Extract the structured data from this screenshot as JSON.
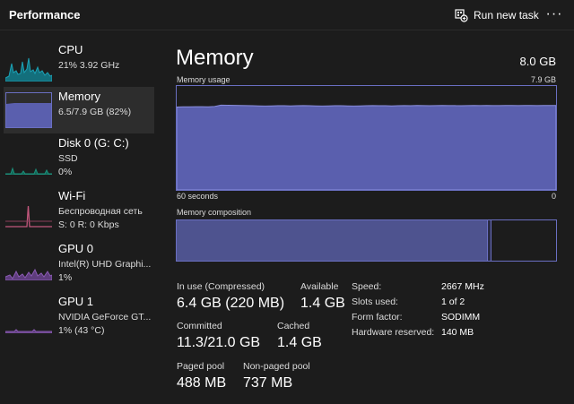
{
  "header": {
    "title": "Performance",
    "run_task_label": "Run new task",
    "more_label": "···"
  },
  "colors": {
    "accent": "#6a6fc2",
    "cpu": "#1ba1b5",
    "disk": "#1b8f7a",
    "wifi": "#c2577c",
    "gpu": "#8a5ab3"
  },
  "sidebar": {
    "items": [
      {
        "name": "CPU",
        "sub1": "21%  3.92 GHz",
        "sub2": ""
      },
      {
        "name": "Memory",
        "sub1": "6.5/7.9 GB (82%)",
        "sub2": ""
      },
      {
        "name": "Disk 0 (G: C:)",
        "sub1": "SSD",
        "sub2": "0%"
      },
      {
        "name": "Wi-Fi",
        "sub1": "Беспроводная сеть",
        "sub2": "S: 0 R: 0 Kbps"
      },
      {
        "name": "GPU 0",
        "sub1": "Intel(R) UHD Graphi...",
        "sub2": "1%"
      },
      {
        "name": "GPU 1",
        "sub1": "NVIDIA GeForce GT...",
        "sub2": "1% (43 °C)"
      }
    ]
  },
  "main": {
    "title": "Memory",
    "total": "8.0 GB",
    "usage_label": "Memory usage",
    "usage_max": "7.9 GB",
    "axis_left": "60 seconds",
    "axis_right": "0",
    "composition_label": "Memory composition",
    "composition": {
      "in_use_fraction": 0.82,
      "modified_fraction": 0.01
    },
    "usage_history_gb": [
      6.3,
      6.32,
      6.32,
      6.33,
      6.33,
      6.32,
      6.35,
      6.45,
      6.44,
      6.43,
      6.42,
      6.41,
      6.4,
      6.39,
      6.38,
      6.39,
      6.4,
      6.4,
      6.39,
      6.4,
      6.41,
      6.4,
      6.39,
      6.38,
      6.39,
      6.4,
      6.4,
      6.39,
      6.38,
      6.39,
      6.4,
      6.41,
      6.4,
      6.4,
      6.39,
      6.4,
      6.41,
      6.4,
      6.42,
      6.41,
      6.4,
      6.41,
      6.42,
      6.41,
      6.41,
      6.4,
      6.41,
      6.42,
      6.41,
      6.42,
      6.41,
      6.41,
      6.42,
      6.42,
      6.41,
      6.42,
      6.42,
      6.41,
      6.42,
      6.42,
      6.42
    ],
    "stats": {
      "in_use_label": "In use (Compressed)",
      "in_use_value": "6.4 GB (220 MB)",
      "available_label": "Available",
      "available_value": "1.4 GB",
      "committed_label": "Committed",
      "committed_value": "11.3/21.0 GB",
      "cached_label": "Cached",
      "cached_value": "1.4 GB",
      "paged_label": "Paged pool",
      "paged_value": "488 MB",
      "nonpaged_label": "Non-paged pool",
      "nonpaged_value": "737 MB"
    },
    "specs": [
      {
        "k": "Speed:",
        "v": "2667 MHz"
      },
      {
        "k": "Slots used:",
        "v": "1 of 2"
      },
      {
        "k": "Form factor:",
        "v": "SODIMM"
      },
      {
        "k": "Hardware reserved:",
        "v": "140 MB"
      }
    ]
  }
}
